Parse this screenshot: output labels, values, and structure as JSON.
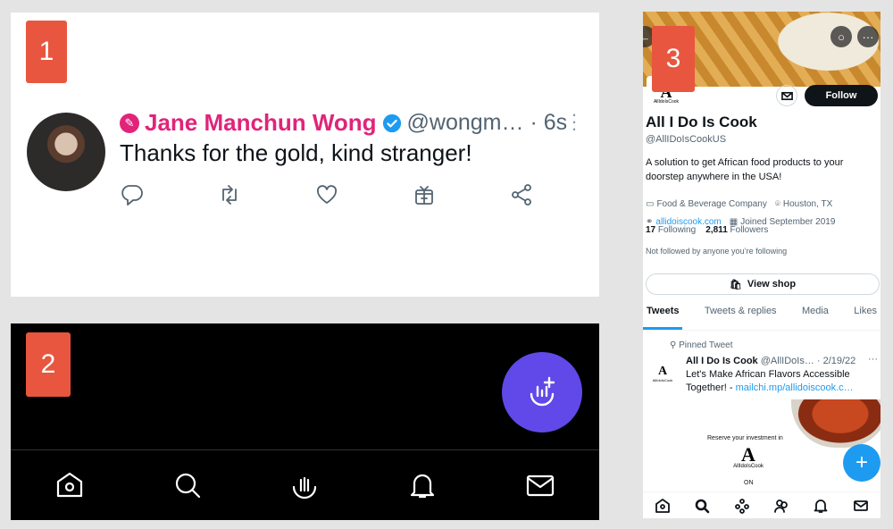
{
  "panels": {
    "p1": {
      "badge": "1",
      "tweet": {
        "display_name": "Jane Manchun Wong",
        "handle_time": "@wongm… · 6s",
        "text": "Thanks for the gold, kind stranger!",
        "actions": [
          "reply-icon",
          "retweet-icon",
          "like-icon",
          "gift-icon",
          "share-icon"
        ]
      },
      "colors": {
        "name": "#e0247a",
        "verified": "#1d9bf0"
      }
    },
    "p2": {
      "badge": "2",
      "fab_icon": "spaces-add-icon",
      "fab_color": "#6049e8",
      "nav_icons": [
        "home-icon",
        "search-icon",
        "spaces-icon",
        "notifications-icon",
        "messages-icon"
      ]
    },
    "p3": {
      "badge": "3",
      "banner_buttons": [
        "back-icon",
        "search-icon",
        "more-icon"
      ],
      "logo_text": "AllIdoIsCook",
      "follow_label": "Follow",
      "name": "All I Do Is Cook",
      "handle": "@AllIDoIsCookUS",
      "bio": "A solution to get African food products to your doorstep anywhere in the USA!",
      "category": "Food & Beverage Company",
      "location": "Houston, TX",
      "website": "allidoiscook.com",
      "joined": "Joined September 2019",
      "following_count": "17",
      "following_label": "Following",
      "followers_count": "2,811",
      "followers_label": "Followers",
      "not_followed": "Not followed by anyone you’re following",
      "view_shop": "View shop",
      "tabs": [
        "Tweets",
        "Tweets & replies",
        "Media",
        "Likes"
      ],
      "pinned_label": "Pinned Tweet",
      "tweet": {
        "name": "All I Do Is Cook",
        "meta": "@AllIDoIs… · 2/19/22",
        "text_prefix": "Let's Make African Flavors Accessible Together! - ",
        "link": "mailchi.mp/allidoiscook.c…"
      },
      "media": {
        "reserve_text": "Reserve your investment in",
        "logo_text": "AllIdoIsCook",
        "on_text": "ON"
      },
      "fab_symbol": "+",
      "nav_icons": [
        "home-icon",
        "search-icon",
        "spaces-icon",
        "communities-icon",
        "notifications-icon",
        "messages-icon"
      ]
    }
  }
}
